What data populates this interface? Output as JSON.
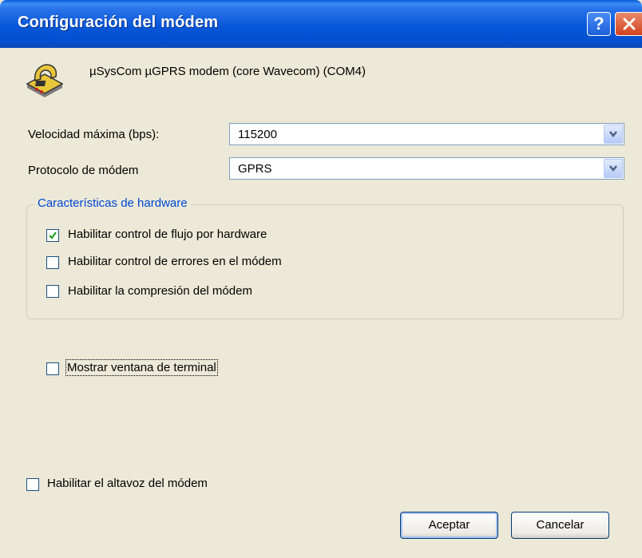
{
  "window": {
    "title": "Configuración del módem"
  },
  "device": {
    "name": "µSysCom µGPRS modem (core Wavecom) (COM4)"
  },
  "speed": {
    "label": "Velocidad máxima (bps):",
    "value": "115200"
  },
  "protocol": {
    "label": "Protocolo de módem",
    "value": "GPRS"
  },
  "hardware": {
    "title": "Características de hardware",
    "flow_control": {
      "label": "Habilitar control de flujo por hardware",
      "checked": true
    },
    "error_control": {
      "label": "Habilitar control de errores en el módem",
      "checked": false
    },
    "compression": {
      "label": "Habilitar la compresión del módem",
      "checked": false
    }
  },
  "terminal": {
    "label": "Mostrar ventana de terminal",
    "checked": false
  },
  "speaker": {
    "label": "Habilitar el altavoz del módem",
    "checked": false
  },
  "buttons": {
    "ok": "Aceptar",
    "cancel": "Cancelar"
  },
  "colors": {
    "titlebar": "#0757d8",
    "dialog_bg": "#ece9d8",
    "group_title": "#0046d5"
  }
}
